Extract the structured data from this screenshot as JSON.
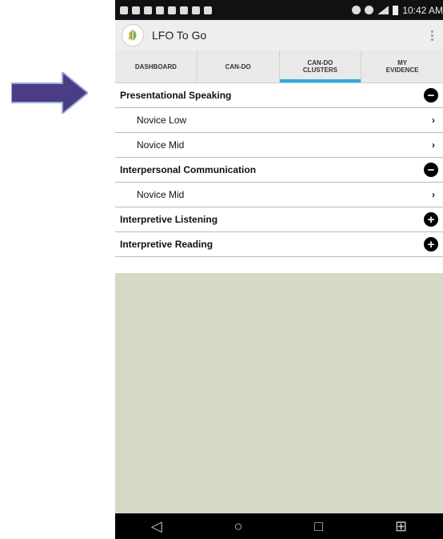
{
  "status_bar": {
    "time": "10:42 AM"
  },
  "app": {
    "title": "LFO To Go"
  },
  "tabs": [
    {
      "label": "DASHBOARD",
      "active": false
    },
    {
      "label": "CAN-DO",
      "active": false
    },
    {
      "label": "CAN-DO CLUSTERS",
      "active": true
    },
    {
      "label": "MY EVIDENCE",
      "active": false
    }
  ],
  "groups": [
    {
      "label": "Presentational Speaking",
      "expanded": true,
      "toggle": "−",
      "items": [
        {
          "label": "Novice Low"
        },
        {
          "label": "Novice Mid"
        }
      ]
    },
    {
      "label": "Interpersonal Communication",
      "expanded": true,
      "toggle": "−",
      "items": [
        {
          "label": "Novice Mid"
        }
      ]
    },
    {
      "label": "Interpretive Listening",
      "expanded": false,
      "toggle": "+",
      "items": []
    },
    {
      "label": "Interpretive Reading",
      "expanded": false,
      "toggle": "+",
      "items": []
    }
  ],
  "chevron": "›",
  "nav": {
    "back": "◁",
    "home": "○",
    "recents": "□",
    "extra": "⊞"
  },
  "colors": {
    "arrow": "#4b3c86",
    "tab_indicator": "#2ea8e0",
    "background": "#d6d9c6"
  }
}
